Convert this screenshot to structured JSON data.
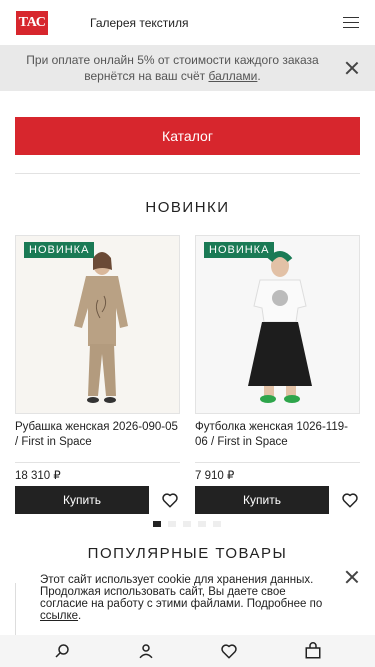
{
  "header": {
    "logo_text": "ТАС",
    "brand_name": "Галерея текстиля"
  },
  "promo": {
    "text_before": "При оплате онлайн 5% от стоимости каждого заказа вернётся на ваш счёт ",
    "link_text": "баллами",
    "text_after": "."
  },
  "catalog_button": "Каталог",
  "new_section": {
    "title": "НОВИНКИ",
    "products": [
      {
        "badge": "НОВИНКА",
        "name": "Рубашка женская 2026-090-05 / First in Space",
        "price": "18 310 ₽",
        "buy_label": "Купить"
      },
      {
        "badge": "НОВИНКА",
        "name": "Футболка женская 1026-119-06 / First in Space",
        "price": "7 910 ₽",
        "buy_label": "Купить"
      }
    ],
    "carousel_pages": 5,
    "carousel_active": 1
  },
  "popular_section": {
    "title": "ПОПУЛЯРНЫЕ ТОВАРЫ"
  },
  "cookie_notice": {
    "text": "Этот сайт использует cookie для хранения данных. Продолжая использовать сайт, Вы даете свое согласие на работу с этими файлами. Подробнее по ",
    "link_text": "ссылке",
    "text_after": "."
  },
  "bottom_nav": {
    "icons": [
      "search-icon",
      "profile-icon",
      "favorites-icon",
      "cart-icon"
    ]
  },
  "colors": {
    "accent_red": "#d7262d",
    "badge_green": "#1a7a55",
    "button_dark": "#222222"
  }
}
